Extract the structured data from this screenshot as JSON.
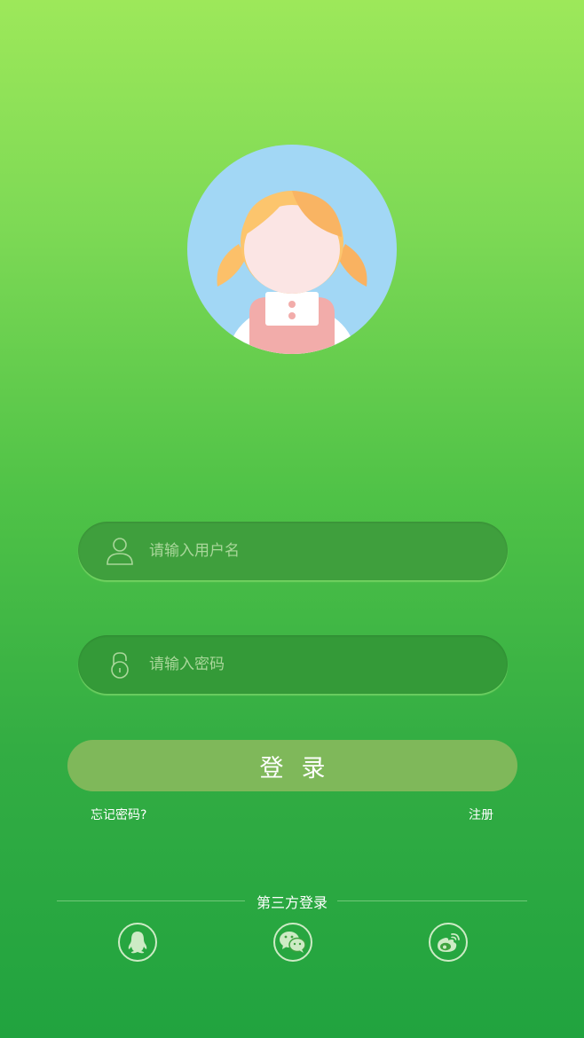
{
  "avatar": {
    "icon": "girl-avatar-icon"
  },
  "form": {
    "username_placeholder": "请输入用户名",
    "username_icon": "user-icon",
    "password_placeholder": "请输入密码",
    "password_icon": "lock-icon",
    "login_label": "登录",
    "forgot_label": "忘记密码?",
    "register_label": "注册"
  },
  "third_party": {
    "label": "第三方登录",
    "items": [
      {
        "icon": "qq-icon"
      },
      {
        "icon": "wechat-icon"
      },
      {
        "icon": "weibo-icon"
      }
    ]
  },
  "colors": {
    "gradient_top": "#9de85a",
    "gradient_bottom": "#21a33f",
    "field_background": "#3ea23f",
    "login_button": "#7fb85a",
    "avatar_background": "#a2d7f5"
  }
}
